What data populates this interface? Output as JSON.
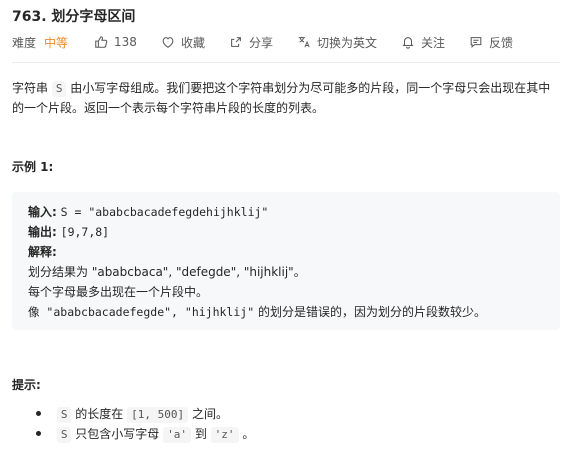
{
  "problem": {
    "title": "763. 划分字母区间"
  },
  "meta": {
    "difficulty_label": "难度",
    "difficulty_value": "中等",
    "likes": "138",
    "favorite_label": "收藏",
    "share_label": "分享",
    "translate_label": "切换为英文",
    "follow_label": "关注",
    "feedback_label": "反馈",
    "difficulty_color": "#ef8a2a"
  },
  "description": {
    "part1": "字符串",
    "code_s": "S",
    "part2": "由小写字母组成。我们要把这个字符串划分为尽可能多的片段，同一个字母只会出现在其中的一个片段。返回一个表示每个字符串片段的长度的列表。"
  },
  "example": {
    "heading": "示例 1:",
    "input_label": "输入:",
    "input_value": "S = \"ababcbacadefegdehijhklij\"",
    "output_label": "输出:",
    "output_value": "[9,7,8]",
    "explain_label": "解释:",
    "explain_line1": "划分结果为 \"ababcbaca\", \"defegde\", \"hijhklij\"。",
    "explain_line2": "每个字母最多出现在一个片段中。",
    "explain_line3_code": "像 \"ababcbacadefegde\", \"hijhklij\"",
    "explain_line3_text": "的划分是错误的，因为划分的片段数较少。"
  },
  "hints": {
    "heading": "提示:",
    "item1_code_s": "S",
    "item1_text_a": "的长度在",
    "item1_code_range": "[1, 500]",
    "item1_text_b": "之间。",
    "item2_code_s": "S",
    "item2_text_a": "只包含小写字母",
    "item2_code_a": "'a'",
    "item2_text_b": "到",
    "item2_code_z": "'z'",
    "item2_text_c": "。"
  }
}
